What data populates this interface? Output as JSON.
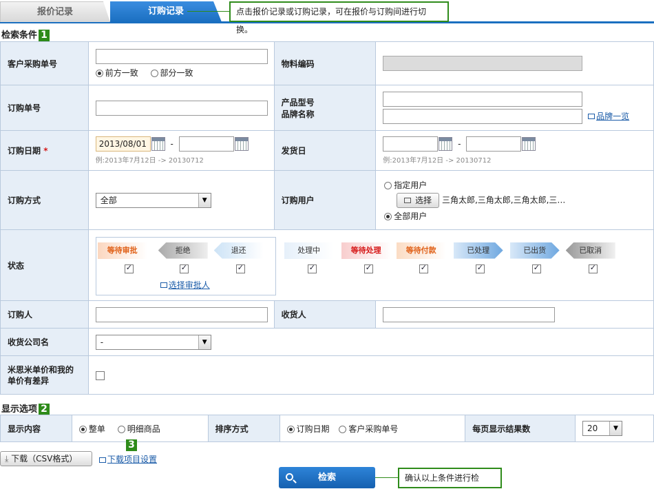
{
  "tabs": {
    "quote_records": "报价记录",
    "order_records": "订购记录"
  },
  "callouts": {
    "tab_switch": "点击报价记录或订购记录，可在报价与订购间进行切换。",
    "search_hint": "确认以上条件进行检索。"
  },
  "badges": {
    "one": "1",
    "two": "2",
    "three": "3"
  },
  "search_conditions": {
    "title": "检索条件",
    "customer_po": {
      "label": "客户采购单号",
      "value": "",
      "opt_prefix": "前方一致",
      "opt_partial": "部分一致",
      "selected": "前方一致"
    },
    "material_code": {
      "label": "物料编码",
      "value": ""
    },
    "order_no": {
      "label": "订购单号",
      "value": ""
    },
    "product_model": {
      "label_model": "产品型号",
      "label_brand": "品牌名称",
      "brand_link": "品牌一览"
    },
    "order_date": {
      "label": "订购日期",
      "required": "*",
      "from": "2013/08/01",
      "to": "",
      "sep": "-",
      "hint": "例:2013年7月12日 -> 20130712"
    },
    "ship_date": {
      "label": "发货日",
      "from": "",
      "to": "",
      "sep": "-",
      "hint": "例:2013年7月12日 -> 20130712"
    },
    "order_method": {
      "label": "订购方式",
      "selected": "全部"
    },
    "order_user": {
      "label": "订购用户",
      "opt_specified": "指定用户",
      "select_btn": "选择",
      "users": "三角太郎,三角太郎,三角太郎,三…",
      "opt_all": "全部用户",
      "selected": "全部用户"
    },
    "status": {
      "label": "状态",
      "group1": [
        {
          "text": "等待审批",
          "checked": true
        },
        {
          "text": "拒绝",
          "checked": true
        },
        {
          "text": "退还",
          "checked": true
        }
      ],
      "approver_link": "选择审批人",
      "group2": [
        {
          "text": "处理中",
          "checked": true
        },
        {
          "text": "等待处理",
          "checked": true
        },
        {
          "text": "等待付款",
          "checked": true
        },
        {
          "text": "已处理",
          "checked": true
        },
        {
          "text": "已出货",
          "checked": true
        },
        {
          "text": "已取消",
          "checked": true
        }
      ]
    },
    "orderer": {
      "label": "订购人",
      "value": ""
    },
    "receiver": {
      "label": "收货人",
      "value": ""
    },
    "receiving_company": {
      "label": "收货公司名",
      "selected": "-"
    },
    "price_diff": {
      "label_line1": "米思米单价和我的",
      "label_line2": "单价有差异",
      "checked": false
    }
  },
  "display_options": {
    "title": "显示选项",
    "content": {
      "label": "显示内容",
      "opt_summary": "整单",
      "opt_detail": "明细商品",
      "selected": "整单"
    },
    "sort": {
      "label": "排序方式",
      "opt_order_date": "订购日期",
      "opt_customer_po": "客户采购单号",
      "selected": "订购日期"
    },
    "per_page": {
      "label": "每页显示结果数",
      "selected": "20"
    }
  },
  "download": {
    "button": "下载（CSV格式）",
    "settings_link": "下载项目设置"
  },
  "search_button": "检索"
}
